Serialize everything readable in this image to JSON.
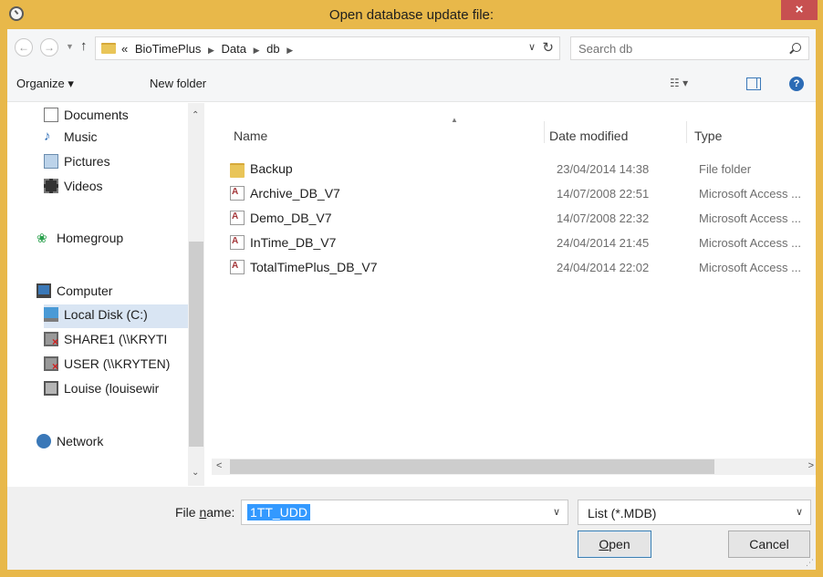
{
  "window": {
    "title": "Open database update file:",
    "close": "×"
  },
  "address": {
    "crumbs_prefix": "«",
    "crumbs": [
      "BioTimePlus",
      "Data",
      "db"
    ],
    "search_placeholder": "Search db"
  },
  "toolbar": {
    "organize": "Organize ▾",
    "new_folder": "New folder",
    "view_menu": "☷ ▾",
    "help": "?"
  },
  "nav_pane": {
    "items": [
      {
        "label": "Documents",
        "icon": "documents-icon"
      },
      {
        "label": "Music",
        "icon": "music-icon"
      },
      {
        "label": "Pictures",
        "icon": "pictures-icon"
      },
      {
        "label": "Videos",
        "icon": "videos-icon"
      },
      {
        "label": "Homegroup",
        "icon": "homegroup-icon"
      },
      {
        "label": "Computer",
        "icon": "computer-icon"
      },
      {
        "label": "Local Disk (C:)",
        "icon": "local-disk-icon",
        "selected": true
      },
      {
        "label": "SHARE1 (\\\\KRYTI",
        "icon": "network-drive-disconnected-icon"
      },
      {
        "label": "USER (\\\\KRYTEN)",
        "icon": "network-drive-disconnected-icon"
      },
      {
        "label": "Louise (louisewir",
        "icon": "user-folder-icon"
      },
      {
        "label": "Network",
        "icon": "network-icon"
      }
    ]
  },
  "file_list": {
    "columns": [
      "Name",
      "Date modified",
      "Type"
    ],
    "rows": [
      {
        "name": "Backup",
        "date": "23/04/2014 14:38",
        "type": "File folder",
        "icon": "folder-icon"
      },
      {
        "name": "Archive_DB_V7",
        "date": "14/07/2008 22:51",
        "type": "Microsoft Access ...",
        "icon": "access-db-icon"
      },
      {
        "name": "Demo_DB_V7",
        "date": "14/07/2008 22:32",
        "type": "Microsoft Access ...",
        "icon": "access-db-icon"
      },
      {
        "name": "InTime_DB_V7",
        "date": "24/04/2014 21:45",
        "type": "Microsoft Access ...",
        "icon": "access-db-icon"
      },
      {
        "name": "TotalTimePlus_DB_V7",
        "date": "24/04/2014 22:02",
        "type": "Microsoft Access ...",
        "icon": "access-db-icon"
      }
    ]
  },
  "bottom": {
    "file_name_label_pre": "File ",
    "file_name_label_u": "n",
    "file_name_label_post": "ame:",
    "file_name_value": "1TT_UDD",
    "filter_value": "List (*.MDB)",
    "open_u": "O",
    "open_rest": "pen",
    "cancel": "Cancel"
  }
}
